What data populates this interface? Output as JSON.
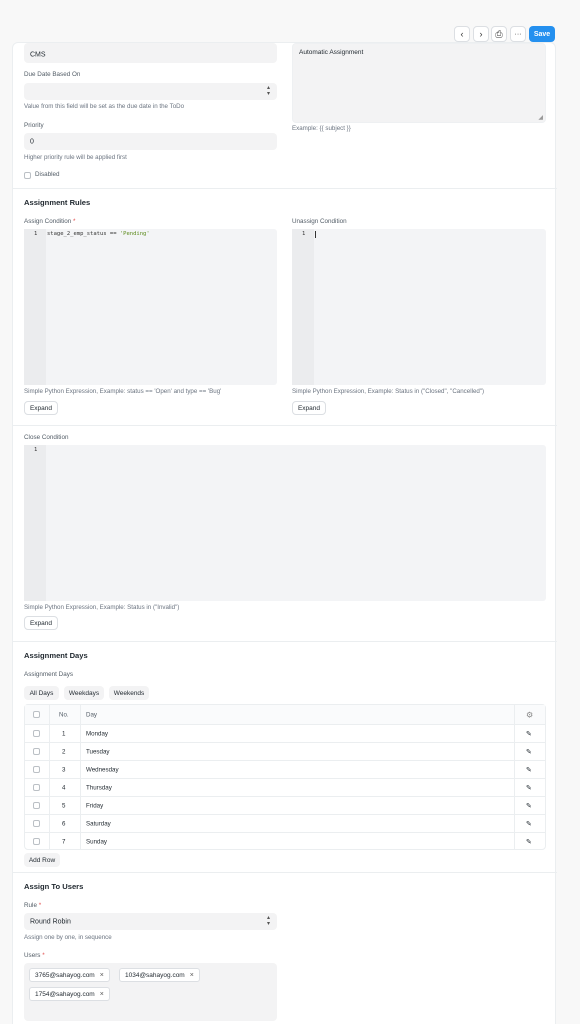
{
  "toolbar": {
    "prev_icon": "‹",
    "next_icon": "›",
    "print_icon": "⎙",
    "more_icon": "···",
    "save_label": "Save"
  },
  "top_fields": {
    "partial_value": "CMS",
    "partial_description": "Automatic Assignment",
    "due_date_label": "Due Date Based On",
    "due_date_value": "",
    "due_date_help": "Value from this field will be set as the due date in the ToDo",
    "priority_label": "Priority",
    "priority_value": "0",
    "priority_help": "Higher priority rule will be applied first",
    "disabled_label": "Disabled",
    "description_example": "Example: {{ subject }}"
  },
  "assignment_rules": {
    "heading": "Assignment Rules",
    "assign_label": "Assign Condition",
    "required_mark": "*",
    "assign_code_line": "1",
    "assign_code_prefix": "stage_2_emp_status == ",
    "assign_code_string": "'Pending'",
    "assign_help": "Simple Python Expression, Example: status == 'Open' and type == 'Bug'",
    "unassign_label": "Unassign Condition",
    "unassign_code_line": "1",
    "unassign_help": "Simple Python Expression, Example: Status in (\"Closed\", \"Cancelled\")",
    "expand_label": "Expand",
    "close_label": "Close Condition",
    "close_code_line": "1",
    "close_help": "Simple Python Expression, Example: Status in (\"Invalid\")"
  },
  "assignment_days": {
    "heading": "Assignment Days",
    "label": "Assignment Days",
    "pills": [
      "All Days",
      "Weekdays",
      "Weekends"
    ],
    "columns": {
      "no": "No.",
      "day": "Day"
    },
    "rows": [
      {
        "no": "1",
        "day": "Monday"
      },
      {
        "no": "2",
        "day": "Tuesday"
      },
      {
        "no": "3",
        "day": "Wednesday"
      },
      {
        "no": "4",
        "day": "Thursday"
      },
      {
        "no": "5",
        "day": "Friday"
      },
      {
        "no": "6",
        "day": "Saturday"
      },
      {
        "no": "7",
        "day": "Sunday"
      }
    ],
    "add_row": "Add Row",
    "edit_icon": "✎",
    "settings_icon": "⚙"
  },
  "assign_users": {
    "heading": "Assign To Users",
    "rule_label": "Rule",
    "rule_value": "Round Robin",
    "rule_help": "Assign one by one, in sequence",
    "users_label": "Users",
    "users": [
      "3765@sahayog.com",
      "1034@sahayog.com",
      "1754@sahayog.com"
    ],
    "remove_icon": "×"
  }
}
